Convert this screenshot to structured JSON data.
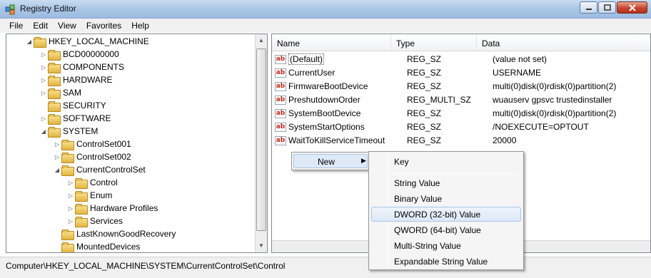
{
  "window": {
    "title": "Registry Editor"
  },
  "menu": [
    "File",
    "Edit",
    "View",
    "Favorites",
    "Help"
  ],
  "tree": [
    {
      "label": "HKEY_LOCAL_MACHINE",
      "expanded": true
    },
    {
      "label": "BCD00000000",
      "expanded": false
    },
    {
      "label": "COMPONENTS",
      "expanded": false
    },
    {
      "label": "HARDWARE",
      "expanded": false
    },
    {
      "label": "SAM",
      "expanded": false
    },
    {
      "label": "SECURITY",
      "expanded": false
    },
    {
      "label": "SOFTWARE",
      "expanded": false
    },
    {
      "label": "SYSTEM",
      "expanded": true
    },
    {
      "label": "ControlSet001",
      "expanded": false
    },
    {
      "label": "ControlSet002",
      "expanded": false
    },
    {
      "label": "CurrentControlSet",
      "expanded": true
    },
    {
      "label": "Control",
      "expanded": false
    },
    {
      "label": "Enum",
      "expanded": false
    },
    {
      "label": "Hardware Profiles",
      "expanded": false
    },
    {
      "label": "Services",
      "expanded": false
    },
    {
      "label": "LastKnownGoodRecovery",
      "expanded": false
    },
    {
      "label": "MountedDevices",
      "expanded": false
    }
  ],
  "list": {
    "columns": [
      "Name",
      "Type",
      "Data"
    ],
    "rows": [
      {
        "name": "(Default)",
        "type": "REG_SZ",
        "data": "(value not set)"
      },
      {
        "name": "CurrentUser",
        "type": "REG_SZ",
        "data": "USERNAME"
      },
      {
        "name": "FirmwareBootDevice",
        "type": "REG_SZ",
        "data": "multi(0)disk(0)rdisk(0)partition(2)"
      },
      {
        "name": "PreshutdownOrder",
        "type": "REG_MULTI_SZ",
        "data": "wuauserv gpsvc trustedinstaller"
      },
      {
        "name": "SystemBootDevice",
        "type": "REG_SZ",
        "data": "multi(0)disk(0)rdisk(0)partition(2)"
      },
      {
        "name": "SystemStartOptions",
        "type": "REG_SZ",
        "data": "/NOEXECUTE=OPTOUT"
      },
      {
        "name": "WaitToKillServiceTimeout",
        "type": "REG_SZ",
        "data": "20000"
      }
    ]
  },
  "context_menu": {
    "new_label": "New",
    "submenu": [
      "Key",
      "String Value",
      "Binary Value",
      "DWORD (32-bit) Value",
      "QWORD (64-bit) Value",
      "Multi-String Value",
      "Expandable String Value"
    ],
    "highlighted": "DWORD (32-bit) Value"
  },
  "status": {
    "path": "Computer\\HKEY_LOCAL_MACHINE\\SYSTEM\\CurrentControlSet\\Control"
  },
  "colors": {
    "titlebar": "#aac6e6",
    "close_button": "#c8452e",
    "selection": "#dce8f7"
  }
}
